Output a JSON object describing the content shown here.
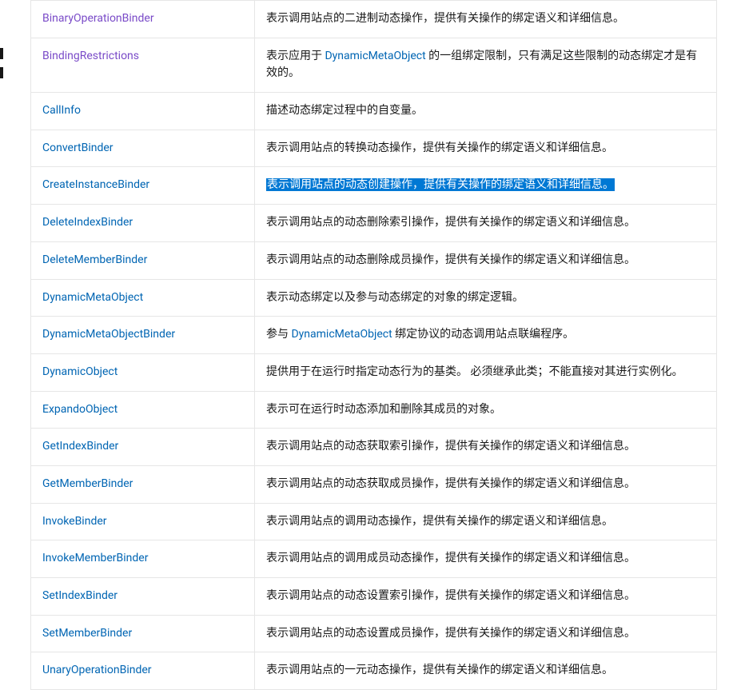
{
  "inlineLinks": {
    "DynamicMetaObject": "DynamicMetaObject"
  },
  "rows": [
    {
      "name": "BinaryOperationBinder",
      "visited": true,
      "desc_parts": [
        {
          "t": "表示调用站点的二进制动态操作，提供有关操作的绑定语义和详细信息。"
        }
      ],
      "selected": false
    },
    {
      "name": "BindingRestrictions",
      "visited": true,
      "desc_parts": [
        {
          "t": "表示应用于 "
        },
        {
          "link": "DynamicMetaObject"
        },
        {
          "t": " 的一组绑定限制，只有满足这些限制的动态绑定才是有效的。"
        }
      ],
      "selected": false
    },
    {
      "name": "CallInfo",
      "visited": false,
      "desc_parts": [
        {
          "t": "描述动态绑定过程中的自变量。"
        }
      ],
      "selected": false
    },
    {
      "name": "ConvertBinder",
      "visited": false,
      "desc_parts": [
        {
          "t": "表示调用站点的转换动态操作，提供有关操作的绑定语义和详细信息。"
        }
      ],
      "selected": false
    },
    {
      "name": "CreateInstanceBinder",
      "visited": false,
      "desc_parts": [
        {
          "t": "表示调用站点的动态创建操作，提供有关操作的绑定语义和详细信息。"
        }
      ],
      "selected": true
    },
    {
      "name": "DeleteIndexBinder",
      "visited": false,
      "desc_parts": [
        {
          "t": "表示调用站点的动态删除索引操作，提供有关操作的绑定语义和详细信息。"
        }
      ],
      "selected": false
    },
    {
      "name": "DeleteMemberBinder",
      "visited": false,
      "desc_parts": [
        {
          "t": "表示调用站点的动态删除成员操作，提供有关操作的绑定语义和详细信息。"
        }
      ],
      "selected": false
    },
    {
      "name": "DynamicMetaObject",
      "visited": false,
      "desc_parts": [
        {
          "t": "表示动态绑定以及参与动态绑定的对象的绑定逻辑。"
        }
      ],
      "selected": false
    },
    {
      "name": "DynamicMetaObjectBinder",
      "visited": false,
      "desc_parts": [
        {
          "t": "参与 "
        },
        {
          "link": "DynamicMetaObject"
        },
        {
          "t": " 绑定协议的动态调用站点联编程序。"
        }
      ],
      "selected": false
    },
    {
      "name": "DynamicObject",
      "visited": false,
      "desc_parts": [
        {
          "t": "提供用于在运行时指定动态行为的基类。 必须继承此类；不能直接对其进行实例化。"
        }
      ],
      "selected": false
    },
    {
      "name": "ExpandoObject",
      "visited": false,
      "desc_parts": [
        {
          "t": "表示可在运行时动态添加和删除其成员的对象。"
        }
      ],
      "selected": false
    },
    {
      "name": "GetIndexBinder",
      "visited": false,
      "desc_parts": [
        {
          "t": "表示调用站点的动态获取索引操作，提供有关操作的绑定语义和详细信息。"
        }
      ],
      "selected": false
    },
    {
      "name": "GetMemberBinder",
      "visited": false,
      "desc_parts": [
        {
          "t": "表示调用站点的动态获取成员操作，提供有关操作的绑定语义和详细信息。"
        }
      ],
      "selected": false
    },
    {
      "name": "InvokeBinder",
      "visited": false,
      "desc_parts": [
        {
          "t": "表示调用站点的调用动态操作，提供有关操作的绑定语义和详细信息。"
        }
      ],
      "selected": false
    },
    {
      "name": "InvokeMemberBinder",
      "visited": false,
      "desc_parts": [
        {
          "t": "表示调用站点的调用成员动态操作，提供有关操作的绑定语义和详细信息。"
        }
      ],
      "selected": false
    },
    {
      "name": "SetIndexBinder",
      "visited": false,
      "desc_parts": [
        {
          "t": "表示调用站点的动态设置索引操作，提供有关操作的绑定语义和详细信息。"
        }
      ],
      "selected": false
    },
    {
      "name": "SetMemberBinder",
      "visited": false,
      "desc_parts": [
        {
          "t": "表示调用站点的动态设置成员操作，提供有关操作的绑定语义和详细信息。"
        }
      ],
      "selected": false
    },
    {
      "name": "UnaryOperationBinder",
      "visited": false,
      "desc_parts": [
        {
          "t": "表示调用站点的一元动态操作，提供有关操作的绑定语义和详细信息。"
        }
      ],
      "selected": false
    }
  ]
}
